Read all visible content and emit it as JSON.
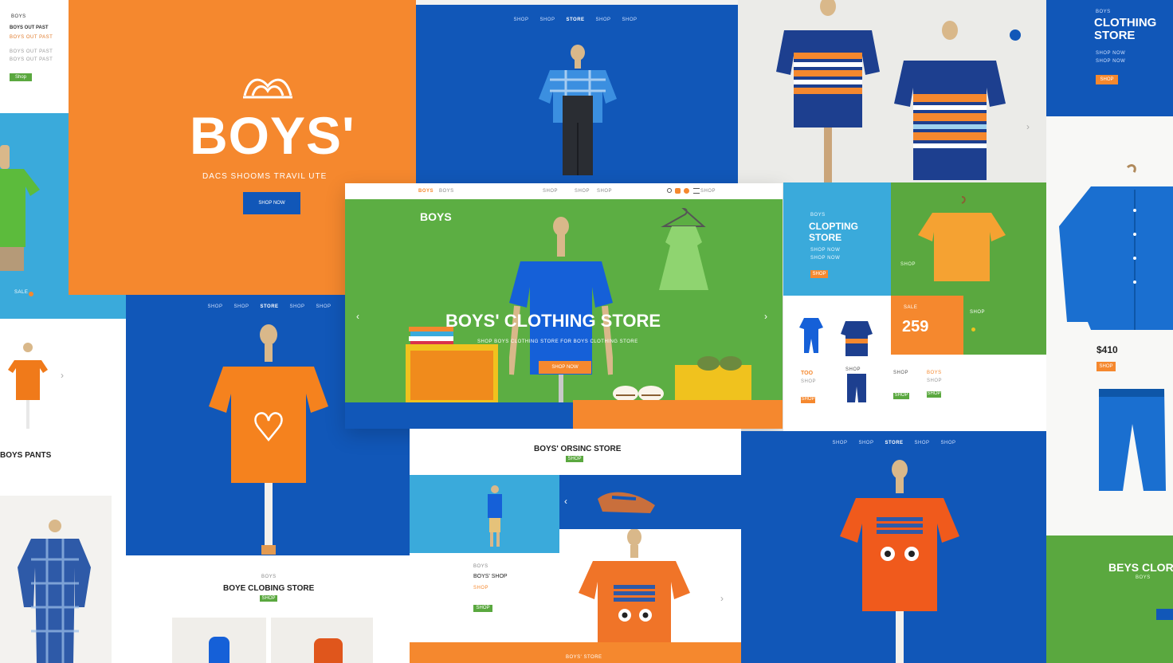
{
  "colors": {
    "orange": "#f5882e",
    "blue": "#1157b8",
    "green": "#5aa83f",
    "sky": "#3aaadb",
    "white": "#ffffff"
  },
  "p1": {
    "kicker": "BOYS",
    "name": "BOYS OUT PAST",
    "sub": "BOYS OUT PAST",
    "button": "Shop"
  },
  "hero_orange": {
    "title": "BOYS'",
    "subtitle": "DACS SHOOMS TRAVIL UTE",
    "button": "SHOP NOW"
  },
  "top_blue": {
    "nav": [
      "SHOP",
      "SHOP",
      "STORE",
      "SHOP",
      "SHOP"
    ]
  },
  "right_top": {
    "kicker": "BOYS",
    "title_line1": "CLOTHING",
    "title_line2": "STORE",
    "desc": "SHOP NOW",
    "button": "SHOP"
  },
  "center": {
    "nav_left": "BOYS",
    "nav_mid": [
      "SHOP",
      "SHOP",
      "SHOP"
    ],
    "nav_right": "SHOP",
    "label": "BOYS",
    "title": "BOYS' CLOTHING STORE",
    "subtitle": "SHOP BOYS CLOTHING STORE FOR BOYS CLOTHING STORE",
    "button": "SHOP NOW"
  },
  "grid_right": {
    "kicker": "BOYS",
    "title_line1": "CLOPTING",
    "title_line2": "STORE",
    "desc": "SHOP NOW",
    "button": "SHOP",
    "mini": "SHOP",
    "price_label": "SALE",
    "price": "259",
    "price_side": "SHOP",
    "items": [
      {
        "name": "TOO",
        "price": "SHOP",
        "btn": "SHOP"
      },
      {
        "name": "SHOP",
        "price": "SHOP",
        "btn": ""
      },
      {
        "name": "SHOP",
        "price": "SHOP",
        "btn": "SHOP"
      },
      {
        "name": "BOYS",
        "price": "SHOP",
        "btn": "SHOP"
      }
    ]
  },
  "far_right": {
    "price": "$410",
    "button": "SHOP",
    "bottom_title": "BEYS CLOR",
    "bottom_sub": "BOYS"
  },
  "left_mid": {
    "price": "SALE",
    "pants_label": "BOYS PANTS"
  },
  "mid_blue": {
    "nav": [
      "SHOP",
      "SHOP",
      "STORE",
      "SHOP",
      "SHOP"
    ],
    "title": "BOYE CLOBING STORE",
    "kicker": "BOYS",
    "button": "SHOP"
  },
  "bottom_center": {
    "title": "BOYS' ORSINC STORE",
    "button": "SHOP",
    "item_kicker": "BOYS",
    "item_title": "BOYS' SHOP",
    "item_price": "SHOP",
    "item_button": "SHOP",
    "footer": "BOYS' STORE"
  },
  "bottom_right": {
    "nav": [
      "SHOP",
      "SHOP",
      "STORE",
      "SHOP",
      "SHOP"
    ]
  },
  "icons": {
    "logo": "crown-logo-icon",
    "prev": "chevron-left-icon",
    "next": "chevron-right-icon",
    "search": "search-icon",
    "cart": "cart-icon",
    "user": "user-icon",
    "menu": "menu-icon"
  }
}
